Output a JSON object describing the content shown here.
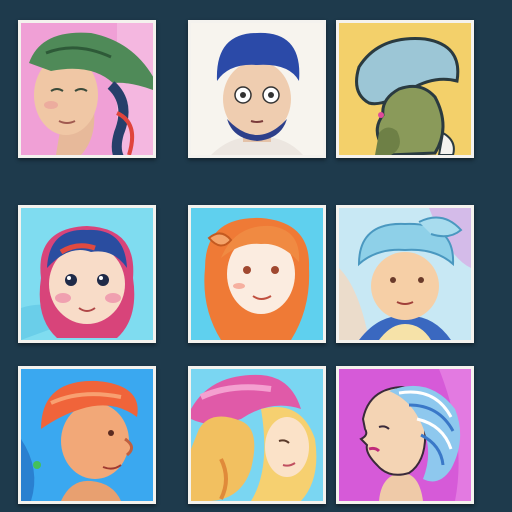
{
  "gallery": {
    "layout": "3x3",
    "background": "#1e3a4c",
    "frame_color": "#f4f2ee",
    "tiles": [
      {
        "subject": "portrait-green-hat-pink-bg",
        "bg": "#f0a0d6"
      },
      {
        "subject": "portrait-blue-hair-beard-white-bg",
        "bg": "#f7f4ee"
      },
      {
        "subject": "abstract-figure-yellow-bg",
        "bg": "#f3d06a"
      },
      {
        "subject": "portrait-girl-red-blue-hair-cyan-bg",
        "bg": "#7fdcf0"
      },
      {
        "subject": "portrait-orange-hair-cyan-bg",
        "bg": "#5fd0ee"
      },
      {
        "subject": "portrait-blue-hair-bun-pastel-bg",
        "bg": "#c8e8f4"
      },
      {
        "subject": "portrait-orange-hair-profile-blue-bg",
        "bg": "#3aa8f0"
      },
      {
        "subject": "portrait-pink-blonde-hair-cyan-bg",
        "bg": "#7ad6f2"
      },
      {
        "subject": "profile-blue-striped-hair-purple-bg",
        "bg": "#d65ad8"
      }
    ]
  }
}
